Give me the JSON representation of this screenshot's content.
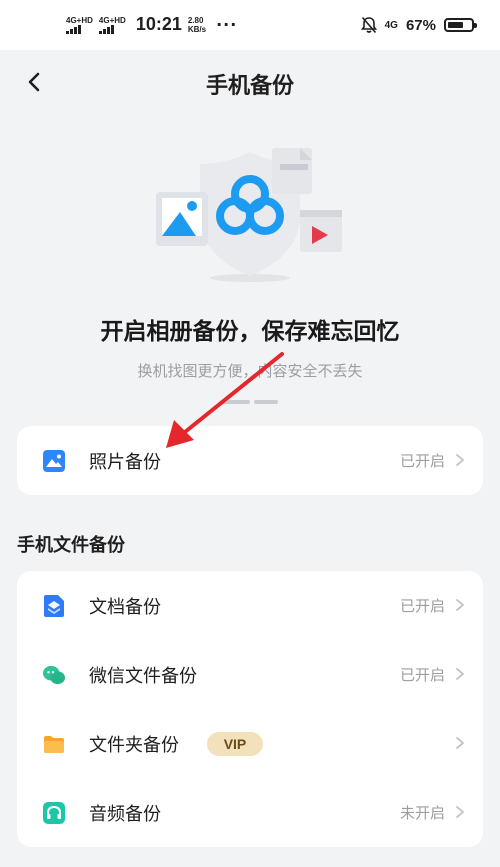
{
  "status_bar": {
    "sim1_label": "4G+HD",
    "sim2_label": "4G+HD",
    "time": "10:21",
    "speed_value": "2.80",
    "speed_unit": "KB/s",
    "more": "···",
    "network_label": "4G",
    "battery_percent": "67%",
    "battery_level": 0.67
  },
  "header": {
    "title": "手机备份"
  },
  "promo": {
    "headline": "开启相册备份，保存难忘回忆",
    "subline": "换机找图更方便，内容安全不丢失"
  },
  "photo_backup": {
    "label": "照片备份",
    "status": "已开启",
    "icon": "photo-icon"
  },
  "file_section": {
    "title": "手机文件备份",
    "items": [
      {
        "label": "文档备份",
        "status": "已开启",
        "icon": "document-icon",
        "color": "#2f7cf6"
      },
      {
        "label": "微信文件备份",
        "status": "已开启",
        "icon": "wechat-icon",
        "color": "#2fc39a"
      },
      {
        "label": "文件夹备份",
        "status": "",
        "badge": "VIP",
        "icon": "folder-icon",
        "color": "#f7a433"
      },
      {
        "label": "音频备份",
        "status": "未开启",
        "icon": "headphones-icon",
        "color": "#1cc6a6"
      }
    ]
  },
  "colors": {
    "accent_blue": "#1d9bf0",
    "arrow_red": "#e5262a",
    "vip_bg": "#f2e1ba"
  }
}
